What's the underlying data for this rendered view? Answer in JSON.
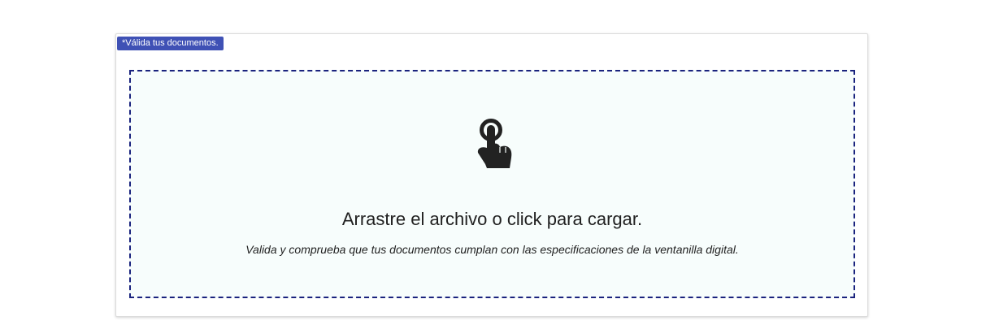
{
  "card": {
    "badge_label": "*Válida tus documentos.",
    "badge_color": "#3f51b5"
  },
  "dropzone": {
    "icon": "touch-hand-icon",
    "title": "Arrastre el archivo o click para cargar.",
    "subtitle": "Valida y comprueba que tus documentos cumplan con las especificaciones de la ventanilla digital.",
    "border_color": "#1a237e",
    "background_color": "#f7fdfc"
  }
}
